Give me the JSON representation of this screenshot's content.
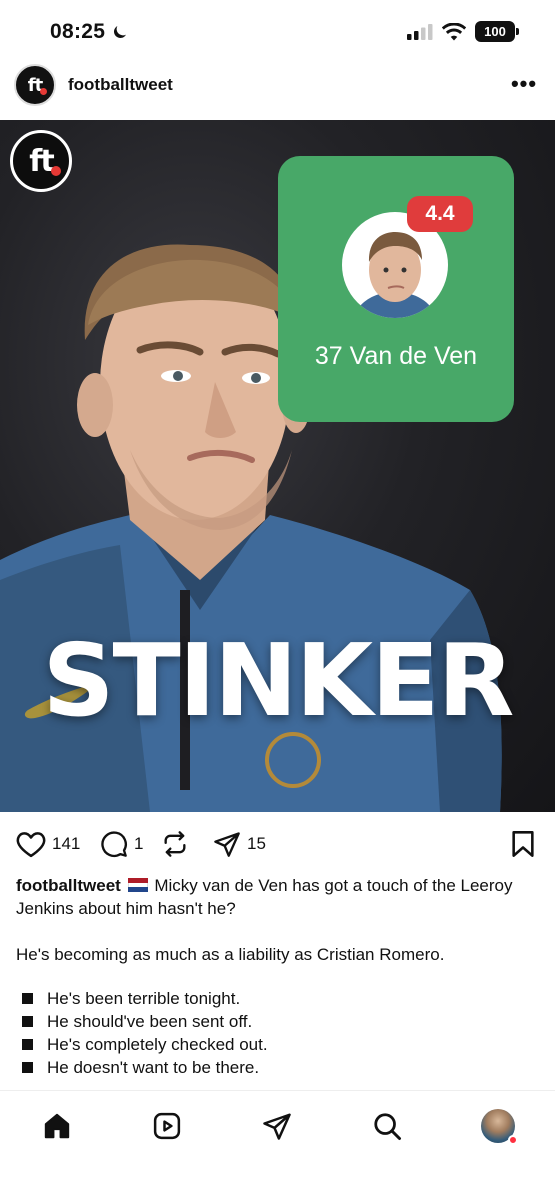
{
  "status_bar": {
    "time": "08:25",
    "battery": "100"
  },
  "post": {
    "username": "footballtweet",
    "more_label": "•••",
    "image": {
      "logo_text": "ft",
      "rating_card": {
        "rating": "4.4",
        "player_label": "37 Van de Ven",
        "card_color": "#48a868",
        "badge_color": "#e03c3c"
      },
      "headline": "STINKER"
    },
    "actions": {
      "likes": "141",
      "comments": "1",
      "shares": "15"
    },
    "caption": {
      "username": "footballtweet",
      "text": "Micky van de Ven has got a touch of the Leeroy Jenkins about him hasn't he?",
      "paragraph2": "He's becoming as much as a liability as Cristian Romero.",
      "bullets": [
        "He's been terrible tonight.",
        "He should've been sent off.",
        "He's completely checked out.",
        "He doesn't want to be there."
      ]
    }
  },
  "icons": {
    "status": [
      "moon-icon",
      "signal-icon",
      "wifi-icon",
      "battery-icon"
    ],
    "actions": [
      "heart-icon",
      "comment-icon",
      "repost-icon",
      "share-icon",
      "bookmark-icon"
    ],
    "nav": [
      "home-icon",
      "reels-icon",
      "send-icon",
      "search-icon",
      "profile-avatar"
    ]
  }
}
